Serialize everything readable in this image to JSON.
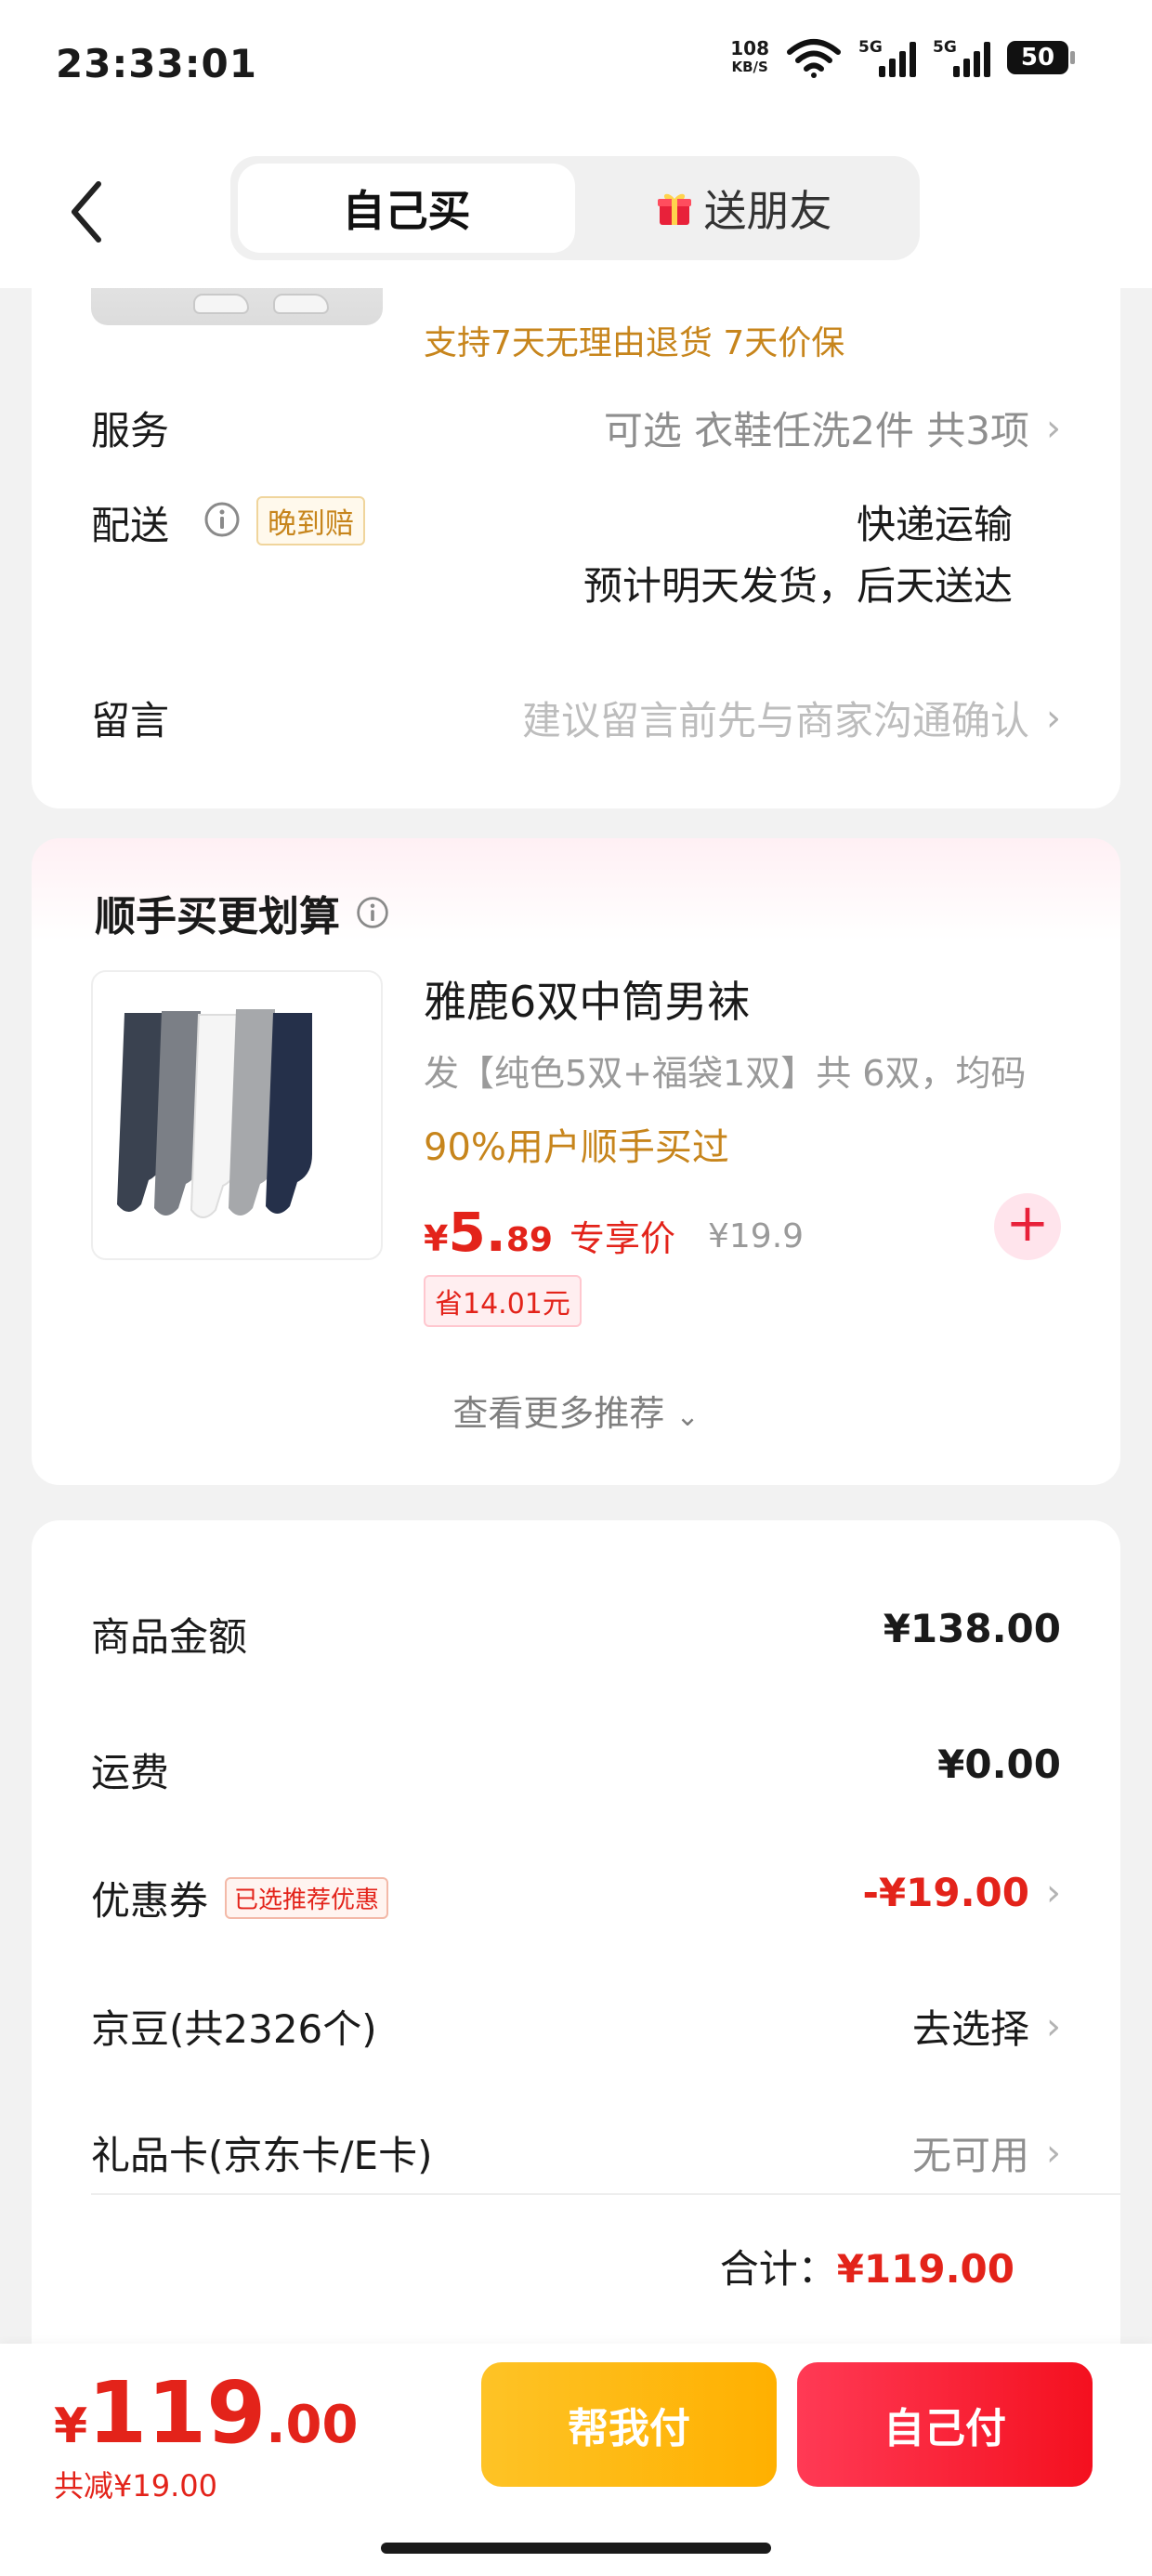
{
  "status_bar": {
    "time": "23:33:01",
    "net_speed": "108",
    "net_unit": "KB/S",
    "signal_1_label": "5G",
    "signal_2_label": "5G",
    "battery": "50"
  },
  "nav": {
    "back_icon": "chevron-left-icon",
    "tab_self": "自己买",
    "tab_gift": "送朋友",
    "gift_icon": "gift-icon"
  },
  "order_info": {
    "guarantee": "支持7天无理由退货  7天价保",
    "service_label": "服务",
    "service_value": "可选 衣鞋任洗2件 共3项",
    "delivery_label": "配送",
    "delivery_badge": "晚到赔",
    "delivery_method": "快递运输",
    "delivery_eta": "预计明天发货，后天送达",
    "note_label": "留言",
    "note_placeholder": "建议留言前先与商家沟通确认"
  },
  "addon": {
    "title": "顺手买更划算",
    "product_name": "雅鹿6双中筒男袜",
    "product_spec": "发【纯色5双+福袋1双】共 6双，均码",
    "bought_text": "90%用户顺手买过",
    "price_yen": "¥",
    "price_int": "5.",
    "price_dec": "89",
    "price_tag": "专享价",
    "original_price": "¥19.9",
    "save_badge": "省14.01元",
    "more_recs": "查看更多推荐",
    "add_icon": "plus-icon"
  },
  "summary": {
    "goods_label": "商品金额",
    "goods_value": "¥138.00",
    "shipping_label": "运费",
    "shipping_value": "¥0.00",
    "coupon_label": "优惠券",
    "coupon_badge": "已选推荐优惠",
    "coupon_value": "-¥19.00",
    "beans_label": "京豆(共2326个)",
    "beans_value": "去选择",
    "giftcard_label": "礼品卡(京东卡/E卡)",
    "giftcard_value": "无可用",
    "total_label": "合计：",
    "total_value": "¥119.00"
  },
  "bottom": {
    "price_yen": "¥",
    "price_int": "119",
    "price_dec": ".00",
    "saved": "共减¥19.00",
    "help_pay": "帮我付",
    "self_pay": "自己付"
  },
  "colors": {
    "accent_red": "#e3231a",
    "gold": "#c7851c",
    "help_btn": "#ffb000",
    "pay_btn": "#f4101f"
  }
}
